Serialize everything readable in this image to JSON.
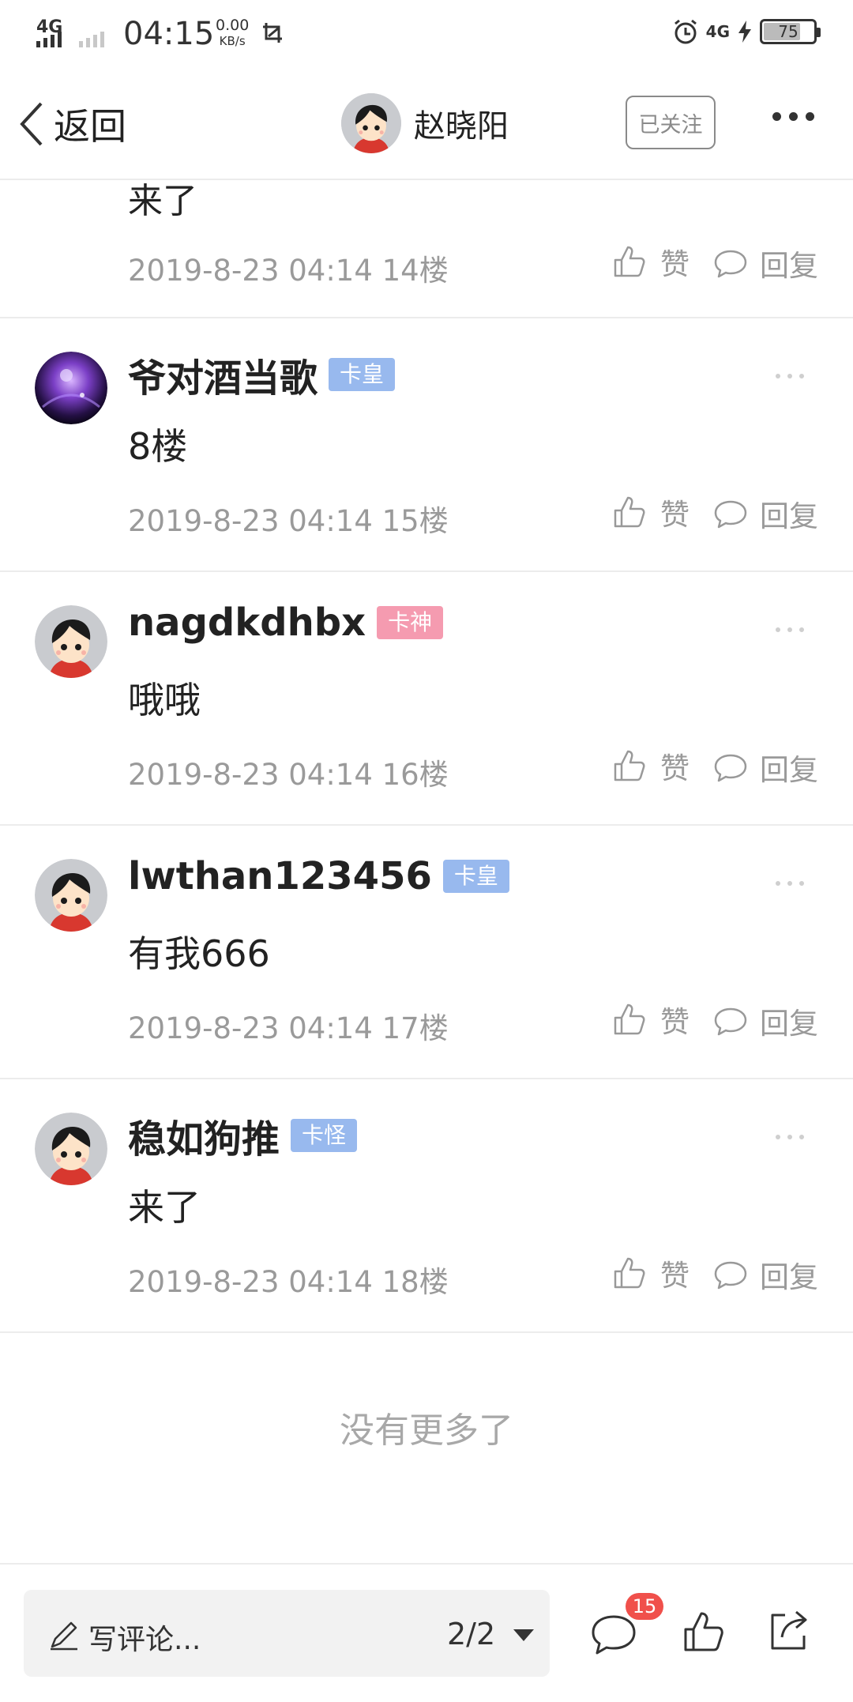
{
  "status_bar": {
    "network": "4G",
    "time": "04:15",
    "speed_value": "0.00",
    "speed_unit": "KB/s",
    "network_right": "4G",
    "battery": "75",
    "icons": [
      "signal-icon",
      "screenshot-icon",
      "alarm-icon",
      "charging-icon",
      "battery-icon"
    ]
  },
  "nav": {
    "back_label": "返回",
    "username": "赵晓阳",
    "follow_label": "已关注"
  },
  "partial_comment": {
    "text": "来了",
    "meta": "2019-8-23 04:14  14楼",
    "like_label": "赞",
    "reply_label": "回复"
  },
  "comments": [
    {
      "name": "爷对酒当歌",
      "badge": "卡皇",
      "badge_color": "#98b9ee",
      "text": "8楼",
      "meta": "2019-8-23 04:14  15楼",
      "like_label": "赞",
      "reply_label": "回复"
    },
    {
      "name": "nagdkdhbx",
      "badge": "卡神",
      "badge_color": "#f59bb0",
      "text": "哦哦",
      "meta": "2019-8-23 04:14  16楼",
      "like_label": "赞",
      "reply_label": "回复"
    },
    {
      "name": "lwthan123456",
      "badge": "卡皇",
      "badge_color": "#98b9ee",
      "text": "有我666",
      "meta": "2019-8-23 04:14  17楼",
      "like_label": "赞",
      "reply_label": "回复"
    },
    {
      "name": "稳如狗推",
      "badge": "卡怪",
      "badge_color": "#98b9ee",
      "text": "来了",
      "meta": "2019-8-23 04:14  18楼",
      "like_label": "赞",
      "reply_label": "回复"
    }
  ],
  "no_more_text": "没有更多了",
  "bottom_bar": {
    "input_placeholder": "写评论...",
    "page_indicator": "2/2",
    "comment_count": "15"
  },
  "colors": {
    "accent_badge_blue": "#98b9ee",
    "accent_badge_pink": "#f59bb0",
    "notification_red": "#f0504b",
    "meta_gray": "#9a9a9a"
  }
}
